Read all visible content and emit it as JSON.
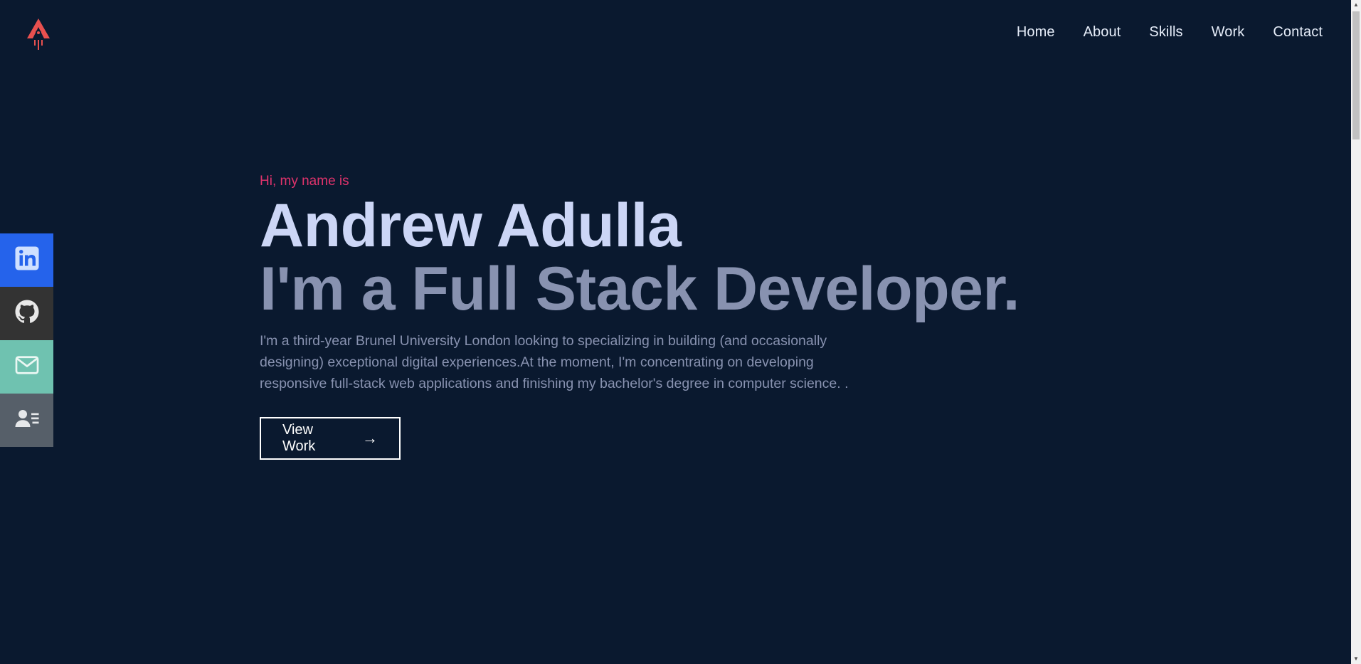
{
  "nav": {
    "items": [
      {
        "label": "Home"
      },
      {
        "label": "About"
      },
      {
        "label": "Skills"
      },
      {
        "label": "Work"
      },
      {
        "label": "Contact"
      }
    ]
  },
  "brand": {
    "logo_icon": "rocket-icon",
    "logo_color": "#e8504f"
  },
  "social": {
    "items": [
      {
        "icon": "linkedin-icon",
        "color": "#2563eb"
      },
      {
        "icon": "github-icon",
        "color": "#333333"
      },
      {
        "icon": "mail-icon",
        "color": "#6fc2b0"
      },
      {
        "icon": "resume-icon",
        "color": "#565f69"
      }
    ]
  },
  "hero": {
    "greeting": "Hi, my name is",
    "name": "Andrew Adulla",
    "role": "I'm a Full Stack Developer.",
    "description": "I'm a third-year Brunel University London looking to specializing in building (and occasionally designing) exceptional digital experiences.At the moment, I'm concentrating on developing responsive full-stack web applications and finishing my bachelor's degree in computer science. .",
    "cta_label": "View Work",
    "cta_icon": "arrow-right-icon"
  },
  "colors": {
    "background": "#0a192f",
    "accent": "#e0336c",
    "heading": "#ccd6f6",
    "muted": "#8892b0"
  }
}
